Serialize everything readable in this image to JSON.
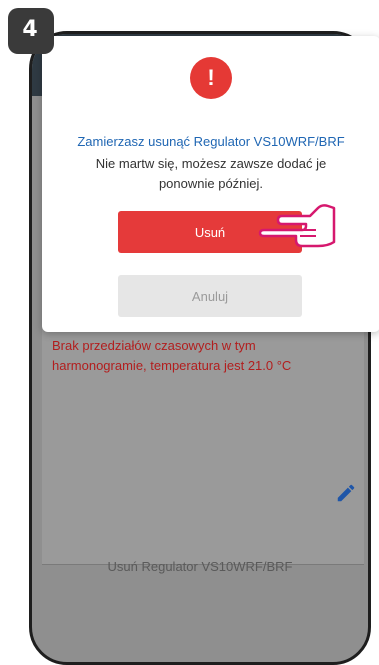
{
  "step_badge": "4",
  "background_screen": {
    "schedule_message": "Brak przedziałów czasowych w tym harmonogramie, temperatura jest 21.0 °C",
    "delete_device_link": "Usuń Regulator VS10WRF/BRF",
    "edit_icon": "pencil-icon"
  },
  "dialog": {
    "icon": "exclamation-icon",
    "icon_glyph": "!",
    "title": "Zamierzasz usunąć Regulator VS10WRF/BRF",
    "message": "Nie martw się, możesz zawsze dodać je ponownie później.",
    "confirm_label": "Usuń",
    "cancel_label": "Anuluj"
  },
  "colors": {
    "accent_red": "#e53a3a",
    "title_blue": "#1f66b3",
    "overlay_grey": "#8f8f8f",
    "hand_outline": "#d6186e"
  }
}
